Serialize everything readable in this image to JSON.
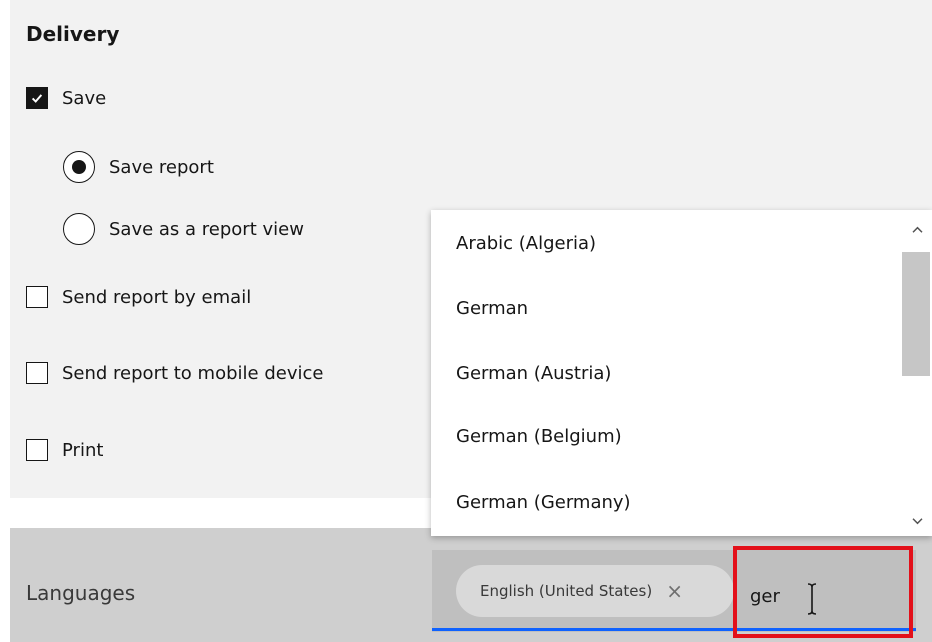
{
  "delivery": {
    "title": "Delivery",
    "save": {
      "label": "Save",
      "checked": true
    },
    "save_options": [
      {
        "label": "Save report",
        "selected": true
      },
      {
        "label": "Save as a report view",
        "selected": false
      }
    ],
    "send_email": {
      "label": "Send report by email",
      "checked": false
    },
    "send_mobile": {
      "label": "Send report to mobile device",
      "checked": false
    },
    "print": {
      "label": "Print",
      "checked": false
    }
  },
  "languages": {
    "label": "Languages",
    "selected_tag": "English (United States)",
    "tag_remove_glyph": "×",
    "input_value": "ger",
    "options": [
      "Arabic (Algeria)",
      "German",
      "German (Austria)",
      "German (Belgium)",
      "German (Germany)"
    ]
  },
  "icons": {
    "checkbox_checked": "checkmark-icon",
    "tag_remove": "close-icon",
    "scroll_up": "chevron-up-icon",
    "scroll_down": "chevron-down-icon",
    "cursor": "text-cursor-icon"
  },
  "colors": {
    "panel_background": "#f2f2f2",
    "language_bar_background": "#cfcfcf",
    "combo_background": "#bfbfbf",
    "focus_underline": "#0f62fe",
    "highlight_border": "#e3101a"
  }
}
